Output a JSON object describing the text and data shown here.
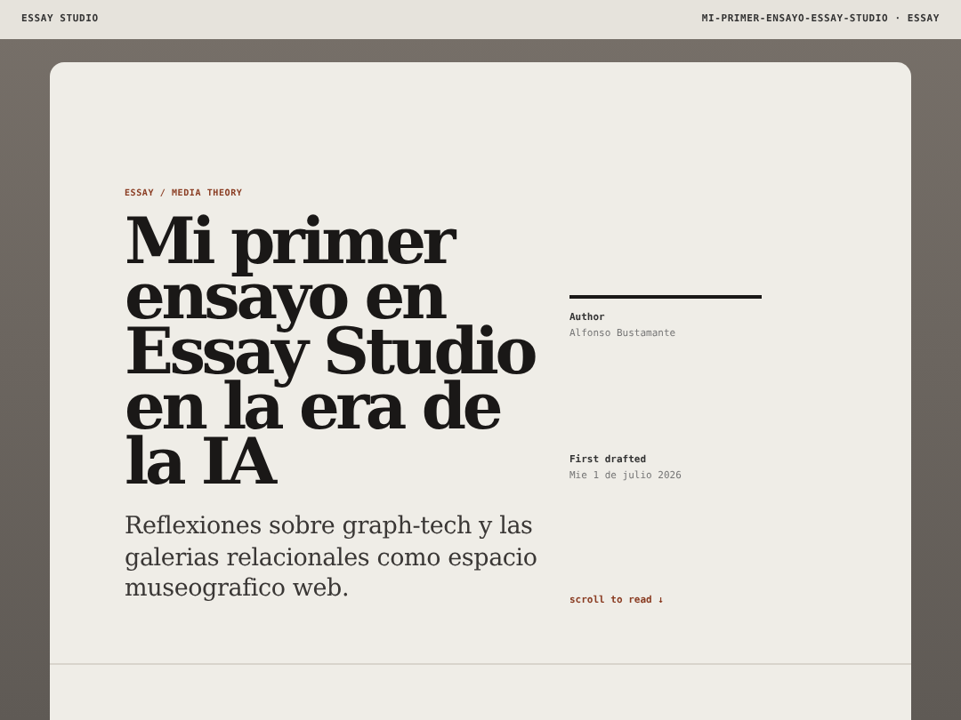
{
  "header": {
    "brand": "ESSAY STUDIO",
    "path": "MI-PRIMER-ENSAYO-ESSAY-STUDIO · ESSAY"
  },
  "essay": {
    "kicker": "ESSAY / MEDIA THEORY",
    "title": "Mi primer ensayo en Essay Studio en la era de la IA",
    "subtitle": "Reflexiones sobre graph-tech y las galerias relacionales como espacio museografico web."
  },
  "meta": [
    {
      "label": "Author",
      "value": "Alfonso Bustamante"
    },
    {
      "label": "First drafted",
      "value": "Mie 1 de julio 2026"
    }
  ],
  "scroll_hint": "scroll to read ↓"
}
